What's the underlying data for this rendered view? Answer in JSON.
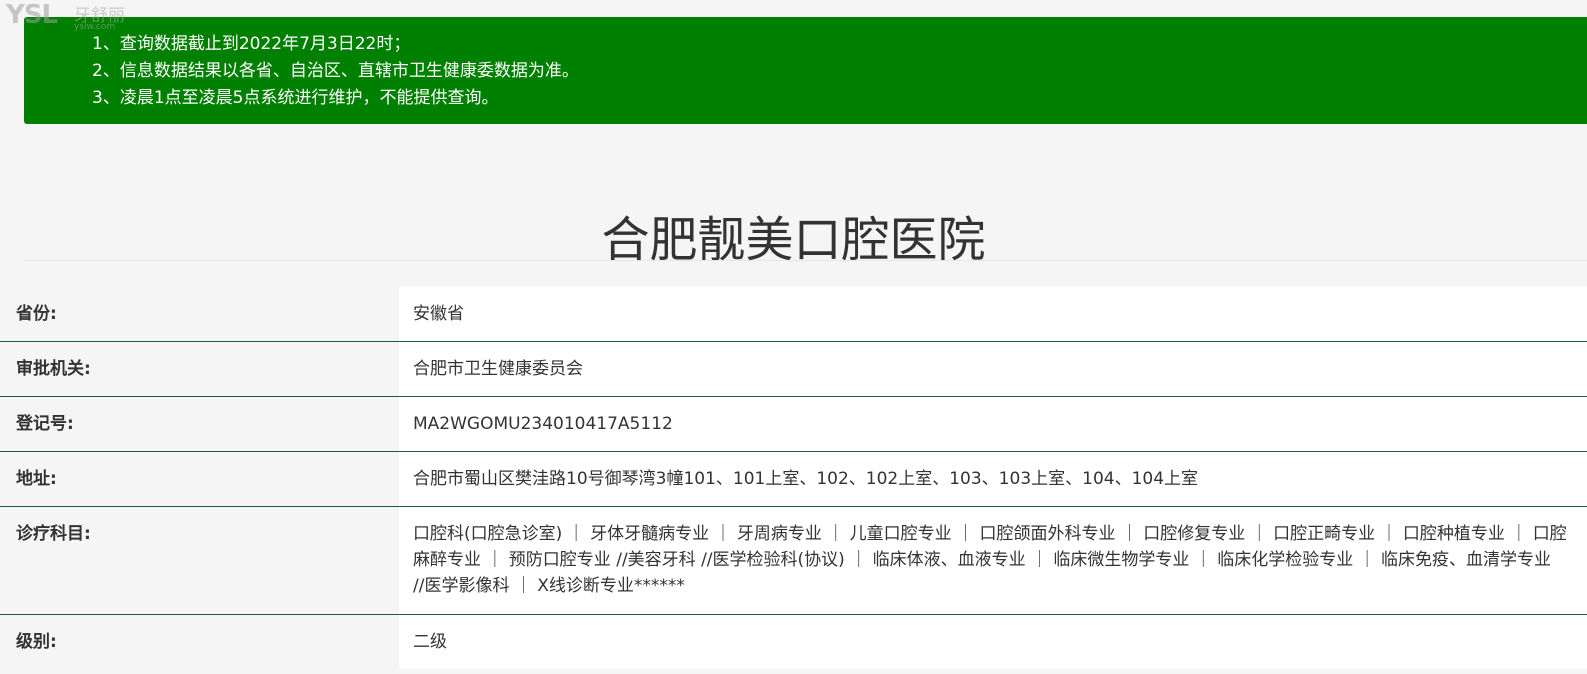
{
  "watermark": {
    "mark": "YSL",
    "brand": "牙舒丽",
    "domain": "yslw.com"
  },
  "notice": {
    "lines": [
      "1、查询数据截止到2022年7月3日22时；",
      "2、信息数据结果以各省、自治区、直辖市卫生健康委数据为准。",
      "3、凌晨1点至凌晨5点系统进行维护，不能提供查询。"
    ],
    "background": "#008000"
  },
  "title": "合肥靓美口腔医院",
  "rows": [
    {
      "label": "省份:",
      "value": "安徽省"
    },
    {
      "label": "审批机关:",
      "value": "合肥市卫生健康委员会"
    },
    {
      "label": "登记号:",
      "value": "MA2WGOMU234010417A5112"
    },
    {
      "label": "地址:",
      "value": "合肥市蜀山区樊洼路10号御琴湾3幢101、101上室、102、102上室、103、103上室、104、104上室"
    },
    {
      "label": "诊疗科目:",
      "value": "口腔科(口腔急诊室) ｜ 牙体牙髓病专业 ｜ 牙周病专业 ｜ 儿童口腔专业 ｜ 口腔颌面外科专业 ｜ 口腔修复专业 ｜ 口腔正畸专业 ｜ 口腔种植专业 ｜ 口腔麻醉专业 ｜ 预防口腔专业 //美容牙科 //医学检验科(协议) ｜ 临床体液、血液专业 ｜ 临床微生物学专业 ｜ 临床化学检验专业 ｜ 临床免疫、血清学专业 //医学影像科 ｜ X线诊断专业******"
    },
    {
      "label": "级别:",
      "value": "二级"
    }
  ],
  "colors": {
    "page_background": "#f5f5f5",
    "row_divider": "#1f5a45",
    "value_background": "#ffffff"
  }
}
